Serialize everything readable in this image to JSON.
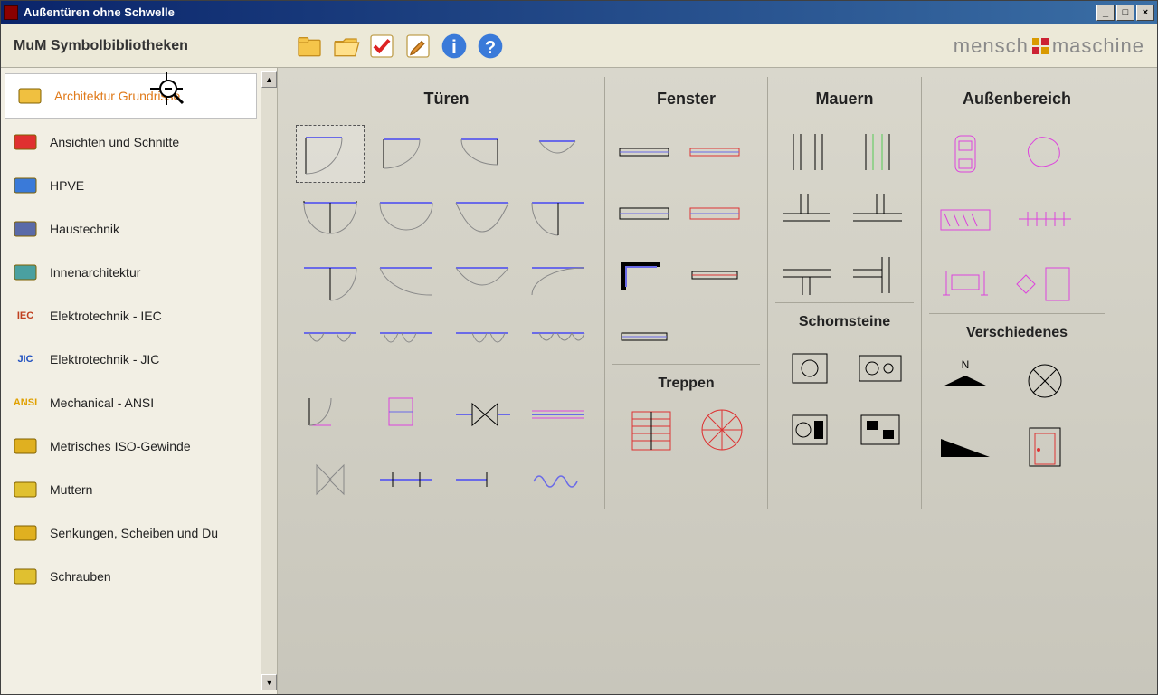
{
  "window": {
    "title": "Außentüren ohne Schwelle"
  },
  "header": {
    "library_title": "MuM Symbolbibliotheken",
    "brand_left": "mensch",
    "brand_right": "maschine"
  },
  "toolbar": {
    "buttons": [
      {
        "name": "folder-icon"
      },
      {
        "name": "open-folder-icon"
      },
      {
        "name": "check-icon"
      },
      {
        "name": "edit-icon"
      },
      {
        "name": "info-icon"
      },
      {
        "name": "help-icon"
      }
    ]
  },
  "sidebar": {
    "items": [
      {
        "label": "Architektur Grundrisse",
        "selected": true,
        "iconColor": "#f0c040",
        "iconText": ""
      },
      {
        "label": "Ansichten und Schnitte",
        "selected": false,
        "iconColor": "#e03030",
        "iconText": ""
      },
      {
        "label": "HPVE",
        "selected": false,
        "iconColor": "#3a7ad9",
        "iconText": ""
      },
      {
        "label": "Haustechnik",
        "selected": false,
        "iconColor": "#5a6aa8",
        "iconText": ""
      },
      {
        "label": "Innenarchitektur",
        "selected": false,
        "iconColor": "#4aa0a0",
        "iconText": ""
      },
      {
        "label": "Elektrotechnik - IEC",
        "selected": false,
        "iconColor": "#c04020",
        "iconText": "IEC"
      },
      {
        "label": "Elektrotechnik - JIC",
        "selected": false,
        "iconColor": "#2050c0",
        "iconText": "JIC"
      },
      {
        "label": "Mechanical - ANSI",
        "selected": false,
        "iconColor": "#e0a000",
        "iconText": "ANSI"
      },
      {
        "label": "Metrisches ISO-Gewinde",
        "selected": false,
        "iconColor": "#e0b020",
        "iconText": ""
      },
      {
        "label": "Muttern",
        "selected": false,
        "iconColor": "#e0c030",
        "iconText": ""
      },
      {
        "label": "Senkungen, Scheiben und Du",
        "selected": false,
        "iconColor": "#e0b020",
        "iconText": ""
      },
      {
        "label": "Schrauben",
        "selected": false,
        "iconColor": "#e0c030",
        "iconText": ""
      }
    ]
  },
  "categories": {
    "col1": {
      "title": "Türen"
    },
    "col2": {
      "title": "Fenster",
      "sub": "Treppen"
    },
    "col3": {
      "title": "Mauern",
      "sub": "Schornsteine"
    },
    "col4": {
      "title": "Außenbereich",
      "sub": "Verschiedenes"
    }
  },
  "misc": {
    "north_label": "N"
  }
}
